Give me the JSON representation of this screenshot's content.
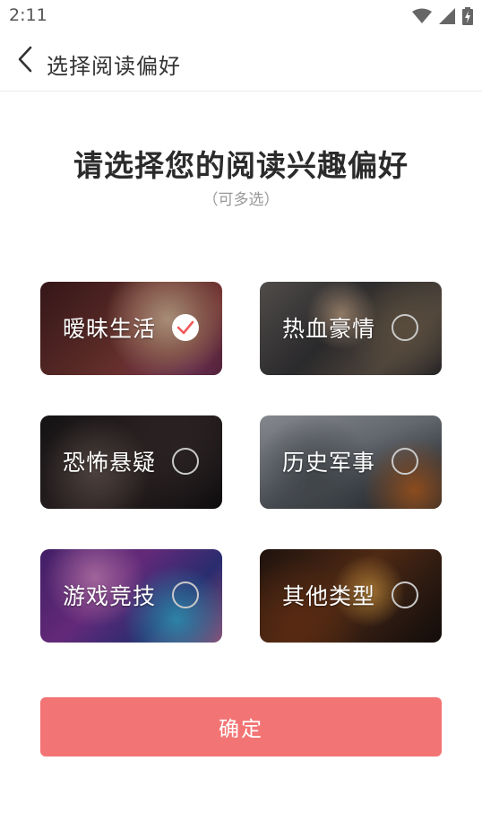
{
  "status_bar": {
    "time": "2:11",
    "icons": [
      "wifi-icon",
      "signal-icon",
      "battery-charging-icon"
    ]
  },
  "app_bar": {
    "title": "选择阅读偏好",
    "back_icon": "chevron-left-icon"
  },
  "heading": "请选择您的阅读兴趣偏好",
  "subheading": "（可多选）",
  "categories": [
    {
      "label": "暧昧生活",
      "selected": true
    },
    {
      "label": "热血豪情",
      "selected": false
    },
    {
      "label": "恐怖悬疑",
      "selected": false
    },
    {
      "label": "历史军事",
      "selected": false
    },
    {
      "label": "游戏竞技",
      "selected": false
    },
    {
      "label": "其他类型",
      "selected": false
    }
  ],
  "confirm_label": "确定",
  "colors": {
    "accent": "#f37474",
    "check": "#f05a5a"
  }
}
